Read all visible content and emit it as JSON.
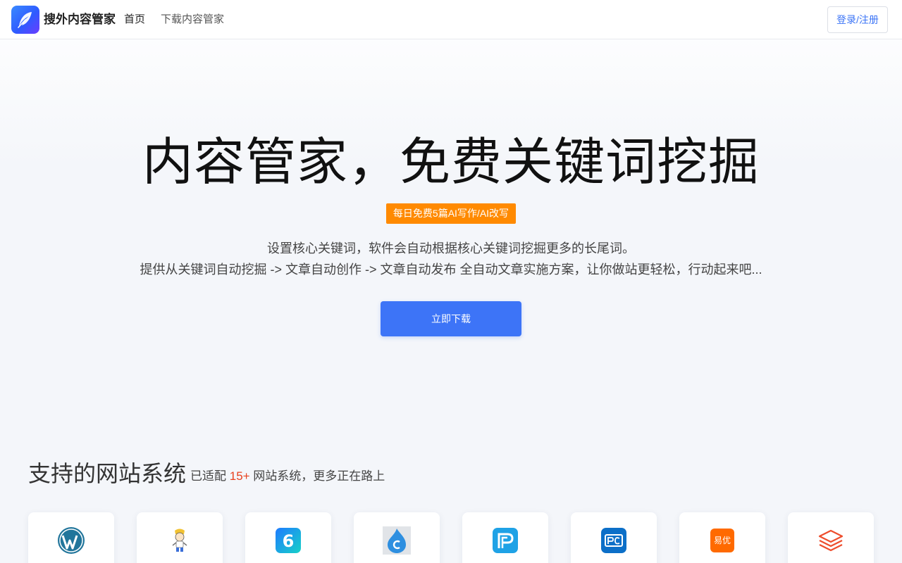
{
  "header": {
    "brand": "搜外内容管家",
    "nav": [
      "首页",
      "下载内容管家"
    ],
    "login_label": "登录/注册"
  },
  "hero": {
    "title": "内容管家，免费关键词挖掘",
    "badge": "每日免费5篇AI写作/AI改写",
    "desc_line1": "设置核心关键词，软件会自动根据核心关键词挖掘更多的长尾词。",
    "desc_line2": "提供从关键词自动挖掘 -> 文章自动创作 -> 文章自动发布 全自动文章实施方案，让你做站更轻松，行动起来吧...",
    "cta_label": "立即下载"
  },
  "systems": {
    "title": "支持的网站系统",
    "sub_prefix": "已适配",
    "sub_count": "15+",
    "sub_suffix": " 网站系统，更多正在路上",
    "items": [
      {
        "icon": "wordpress-icon"
      },
      {
        "icon": "mascot-icon"
      },
      {
        "icon": "six-icon"
      },
      {
        "icon": "flame-c-icon"
      },
      {
        "icon": "p-logo-icon"
      },
      {
        "icon": "pc-logo-icon"
      },
      {
        "icon": "yiyou-icon",
        "text": "易优"
      },
      {
        "icon": "layers-icon"
      }
    ]
  },
  "colors": {
    "primary": "#3d74f7",
    "badge": "#ff8a00",
    "highlight": "#e8411e"
  }
}
